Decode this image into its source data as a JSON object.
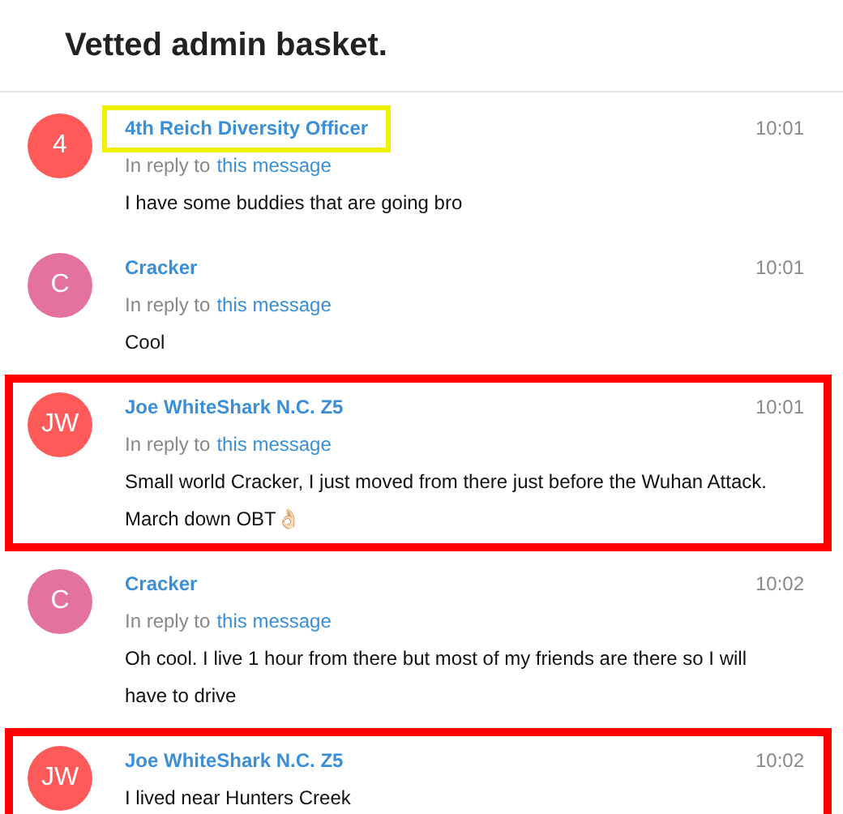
{
  "header": {
    "title": "Vetted admin basket."
  },
  "messages": [
    {
      "avatar": {
        "initials": "4",
        "color": "#ff5a5a"
      },
      "name": "4th Reich Diversity Officer",
      "time": "10:01",
      "reply": {
        "prefix": "In reply to",
        "link": "this message"
      },
      "text": "I have some buddies that are going bro",
      "highlight": {
        "kind": "name",
        "color": "#f0f000"
      }
    },
    {
      "avatar": {
        "initials": "C",
        "color": "#e4729f"
      },
      "name": "Cracker",
      "time": "10:01",
      "reply": {
        "prefix": "In reply to",
        "link": "this message"
      },
      "text": "Cool"
    },
    {
      "avatar": {
        "initials": "JW",
        "color": "#ff5a5a"
      },
      "name": "Joe WhiteShark N.C. Z5",
      "time": "10:01",
      "reply": {
        "prefix": "In reply to",
        "link": "this message"
      },
      "text": "Small world Cracker, I just moved from there just before the Wuhan Attack. March down OBT👌🏻",
      "highlight": {
        "kind": "message",
        "color": "#ff0000"
      }
    },
    {
      "avatar": {
        "initials": "C",
        "color": "#e4729f"
      },
      "name": "Cracker",
      "time": "10:02",
      "reply": {
        "prefix": "In reply to",
        "link": "this message"
      },
      "text": "Oh cool. I live 1 hour from there but most of my friends are there so I will have to drive"
    },
    {
      "avatar": {
        "initials": "JW",
        "color": "#ff5a5a"
      },
      "name": "Joe WhiteShark N.C. Z5",
      "time": "10:02",
      "text": "I lived near Hunters Creek",
      "highlight": {
        "kind": "message",
        "color": "#ff0000"
      }
    }
  ]
}
